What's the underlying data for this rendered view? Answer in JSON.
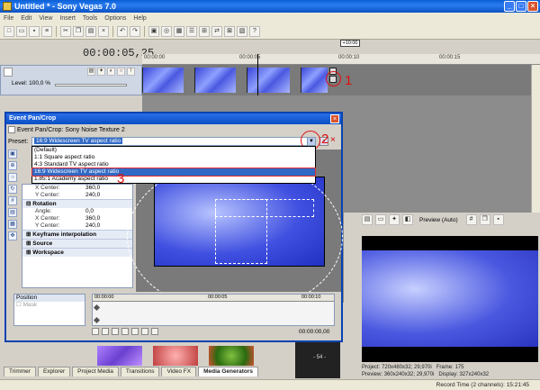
{
  "window": {
    "title": "Untitled * - Sony Vegas 7.0"
  },
  "menu": [
    "File",
    "Edit",
    "View",
    "Insert",
    "Tools",
    "Options",
    "Help"
  ],
  "timeline": {
    "cursor_time": "00:00:05,25",
    "ruler_labels": [
      "00:00:00",
      "00:00:05",
      "00:00:10",
      "00:00:15"
    ],
    "loop_marker": "+10:00",
    "track_level": "Level: 100,0 %"
  },
  "dialog": {
    "title": "Event Pan/Crop",
    "subtitle": "Event Pan/Crop: Sony Noise Texture 2",
    "preset_label": "Preset:",
    "preset_value": "16:9 Widescreen TV aspect ratio",
    "preset_options": [
      "(Default)",
      "1:1 Square aspect ratio",
      "4:3 Standard TV aspect ratio",
      "16:9 Widescreen TV aspect ratio",
      "1.85:1 Academy aspect ratio"
    ],
    "properties": {
      "x_center_label": "X Center:",
      "x_center_value": "360,0",
      "y_center_label": "Y Center:",
      "y_center_value": "240,0",
      "rotation_section": "Rotation",
      "angle_label": "Angle:",
      "angle_value": "0,0",
      "rot_x_label": "X Center:",
      "rot_x_value": "360,0",
      "rot_y_label": "Y Center:",
      "rot_y_value": "240,0",
      "kf_interp": "Keyframe interpolation",
      "source": "Source",
      "workspace": "Workspace"
    },
    "keyframe": {
      "position_label": "Position",
      "mask_label": "Mask",
      "ruler": [
        "00:00:00",
        "00:00:05",
        "00:00:10"
      ],
      "time": "00:00:00,00"
    }
  },
  "annotations": {
    "one": "1",
    "two": "2",
    "three": "3"
  },
  "preview": {
    "mode": "Preview (Auto)",
    "project_label": "Project:",
    "project_value": "720x480x32; 29,970i",
    "preview_label": "Preview:",
    "preview_value": "360x240x32; 29,970i",
    "frame_label": "Frame:",
    "frame_value": "175",
    "display_label": "Display:",
    "display_value": "327x240x32"
  },
  "tabs": [
    "Trimmer",
    "Explorer",
    "Project Media",
    "Transitions",
    "Video FX",
    "Media Generators"
  ],
  "active_tab": "Media Generators",
  "status": "Record Time (2 channels): 15:21:45"
}
